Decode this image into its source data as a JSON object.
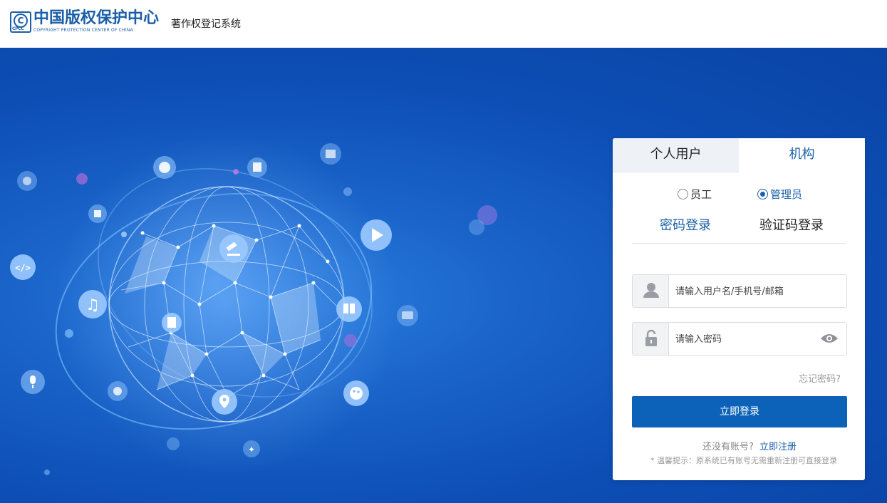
{
  "header": {
    "logo_cn": "中国版权保护中心",
    "logo_en": "COPYRIGHT PROTECTION CENTER OF CHINA",
    "logo_mark": "CPCC",
    "system_title": "著作权登记系统"
  },
  "login": {
    "tabs": [
      {
        "label": "个人用户",
        "active": false
      },
      {
        "label": "机构",
        "active": true
      }
    ],
    "roles": [
      {
        "label": "员工",
        "checked": false
      },
      {
        "label": "管理员",
        "checked": true
      }
    ],
    "modes": [
      {
        "label": "密码登录",
        "active": true
      },
      {
        "label": "验证码登录",
        "active": false
      }
    ],
    "username_placeholder": "请输入用户名/手机号/邮箱",
    "password_placeholder": "请输入密码",
    "forgot_label": "忘记密码?",
    "submit_label": "立即登录",
    "register_question": "还没有账号?",
    "register_link": "立即注册",
    "tip": "* 温馨提示：原系统已有账号无需重新注册可直接登录"
  },
  "colors": {
    "brand": "#1a5fa8",
    "button": "#0b62b8",
    "hero_bg": "#0d4fb6"
  },
  "icons": [
    "user-icon",
    "lock-icon",
    "eye-icon",
    "play-icon",
    "music-icon",
    "code-icon",
    "gavel-icon",
    "book-icon",
    "location-icon",
    "palette-icon",
    "microphone-icon",
    "film-reel-icon",
    "camera-icon",
    "cube-icon",
    "image-icon",
    "building-icon",
    "mask-icon",
    "dancer-icon",
    "compass-icon",
    "bookmark-icon"
  ]
}
